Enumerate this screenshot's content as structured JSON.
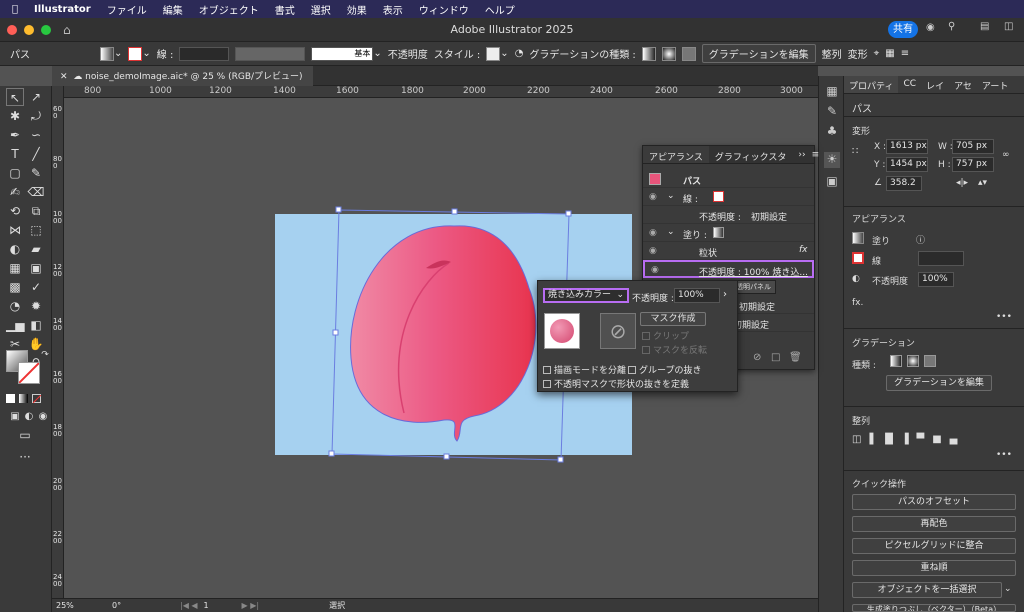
{
  "menubar": {
    "app": "Illustrator",
    "items": [
      "ファイル",
      "編集",
      "オブジェクト",
      "書式",
      "選択",
      "効果",
      "表示",
      "ウィンドウ",
      "ヘルプ"
    ]
  },
  "window": {
    "title": "Adobe Illustrator 2025",
    "share": "共有"
  },
  "control": {
    "object": "パス",
    "stroke": "線 :",
    "brush": "基本",
    "opacity": "不透明度",
    "style": "スタイル :",
    "gradient_type": "グラデーションの種類 :",
    "edit_gradient": "グラデーションを編集",
    "align": "整列",
    "transform": "変形"
  },
  "doc": {
    "tab": "noise_demoImage.aic* @ 25 % (RGB/プレビュー)"
  },
  "ruler": {
    "h": [
      "800",
      "1000",
      "1200",
      "1400",
      "1600",
      "1800",
      "2000",
      "2200",
      "2400",
      "2600",
      "2800",
      "3000"
    ],
    "v": [
      "600",
      "800",
      "1000",
      "1200",
      "1400",
      "1600",
      "1800",
      "2000",
      "2200",
      "2400"
    ]
  },
  "status": {
    "zoom": "25%",
    "angle": "0°",
    "page": "1",
    "mode": "選択"
  },
  "props": {
    "tabs": [
      "プロパティ",
      "CC",
      "レイ",
      "アセ",
      "アート"
    ],
    "kind": "パス",
    "transform": {
      "title": "変形",
      "x_label": "X :",
      "x": "1613 px",
      "y_label": "Y :",
      "y": "1454 px",
      "w_label": "W :",
      "w": "705 px",
      "h_label": "H :",
      "h": "757 px",
      "angle": "358.2"
    },
    "appearance": {
      "title": "アピアランス",
      "fill": "塗り",
      "stroke": "線",
      "opacity_label": "不透明度",
      "opacity": "100%"
    },
    "gradient": {
      "title": "グラデーション",
      "type": "種類 :",
      "edit": "グラデーションを編集"
    },
    "align": {
      "title": "整列"
    },
    "quick": {
      "title": "クイック操作",
      "buttons": [
        "パスのオフセット",
        "再配色",
        "ピクセルグリッドに整合",
        "重ね順",
        "オブジェクトを一括選択"
      ],
      "cut": "生成塗りつぶし（ベクター）（Beta）"
    }
  },
  "appearance_panel": {
    "tabs": [
      "アピアランス",
      "グラフィックスタ"
    ],
    "rows": [
      {
        "label": "パス"
      },
      {
        "label": "線 :"
      },
      {
        "label": "不透明度 :",
        "value": "初期設定"
      },
      {
        "label": "塗り :"
      },
      {
        "label": "粒状",
        "fx": "fx"
      },
      {
        "label": "不透明度 : 100% 焼き込..."
      },
      {
        "label": "不透明度 :",
        "value": "初期設定"
      },
      {
        "label": "不透明度 :",
        "value": "初期設定"
      }
    ]
  },
  "transparency": {
    "blend": "焼き込みカラー",
    "opacity_label": "不透明度 :",
    "opacity": "100%",
    "make_mask": "マスク作成",
    "clip": "クリップ",
    "invert": "マスクを反転",
    "isolate": "描画モードを分離",
    "knockout": "グループの抜き",
    "define": "不透明マスクで形状の抜きを定義",
    "tooltip": "透明パネル"
  },
  "colors": {
    "accent": "#1473e6",
    "highlight": "#b86df2",
    "artboard": "#a6d1f0",
    "peach": "#e8557b"
  }
}
